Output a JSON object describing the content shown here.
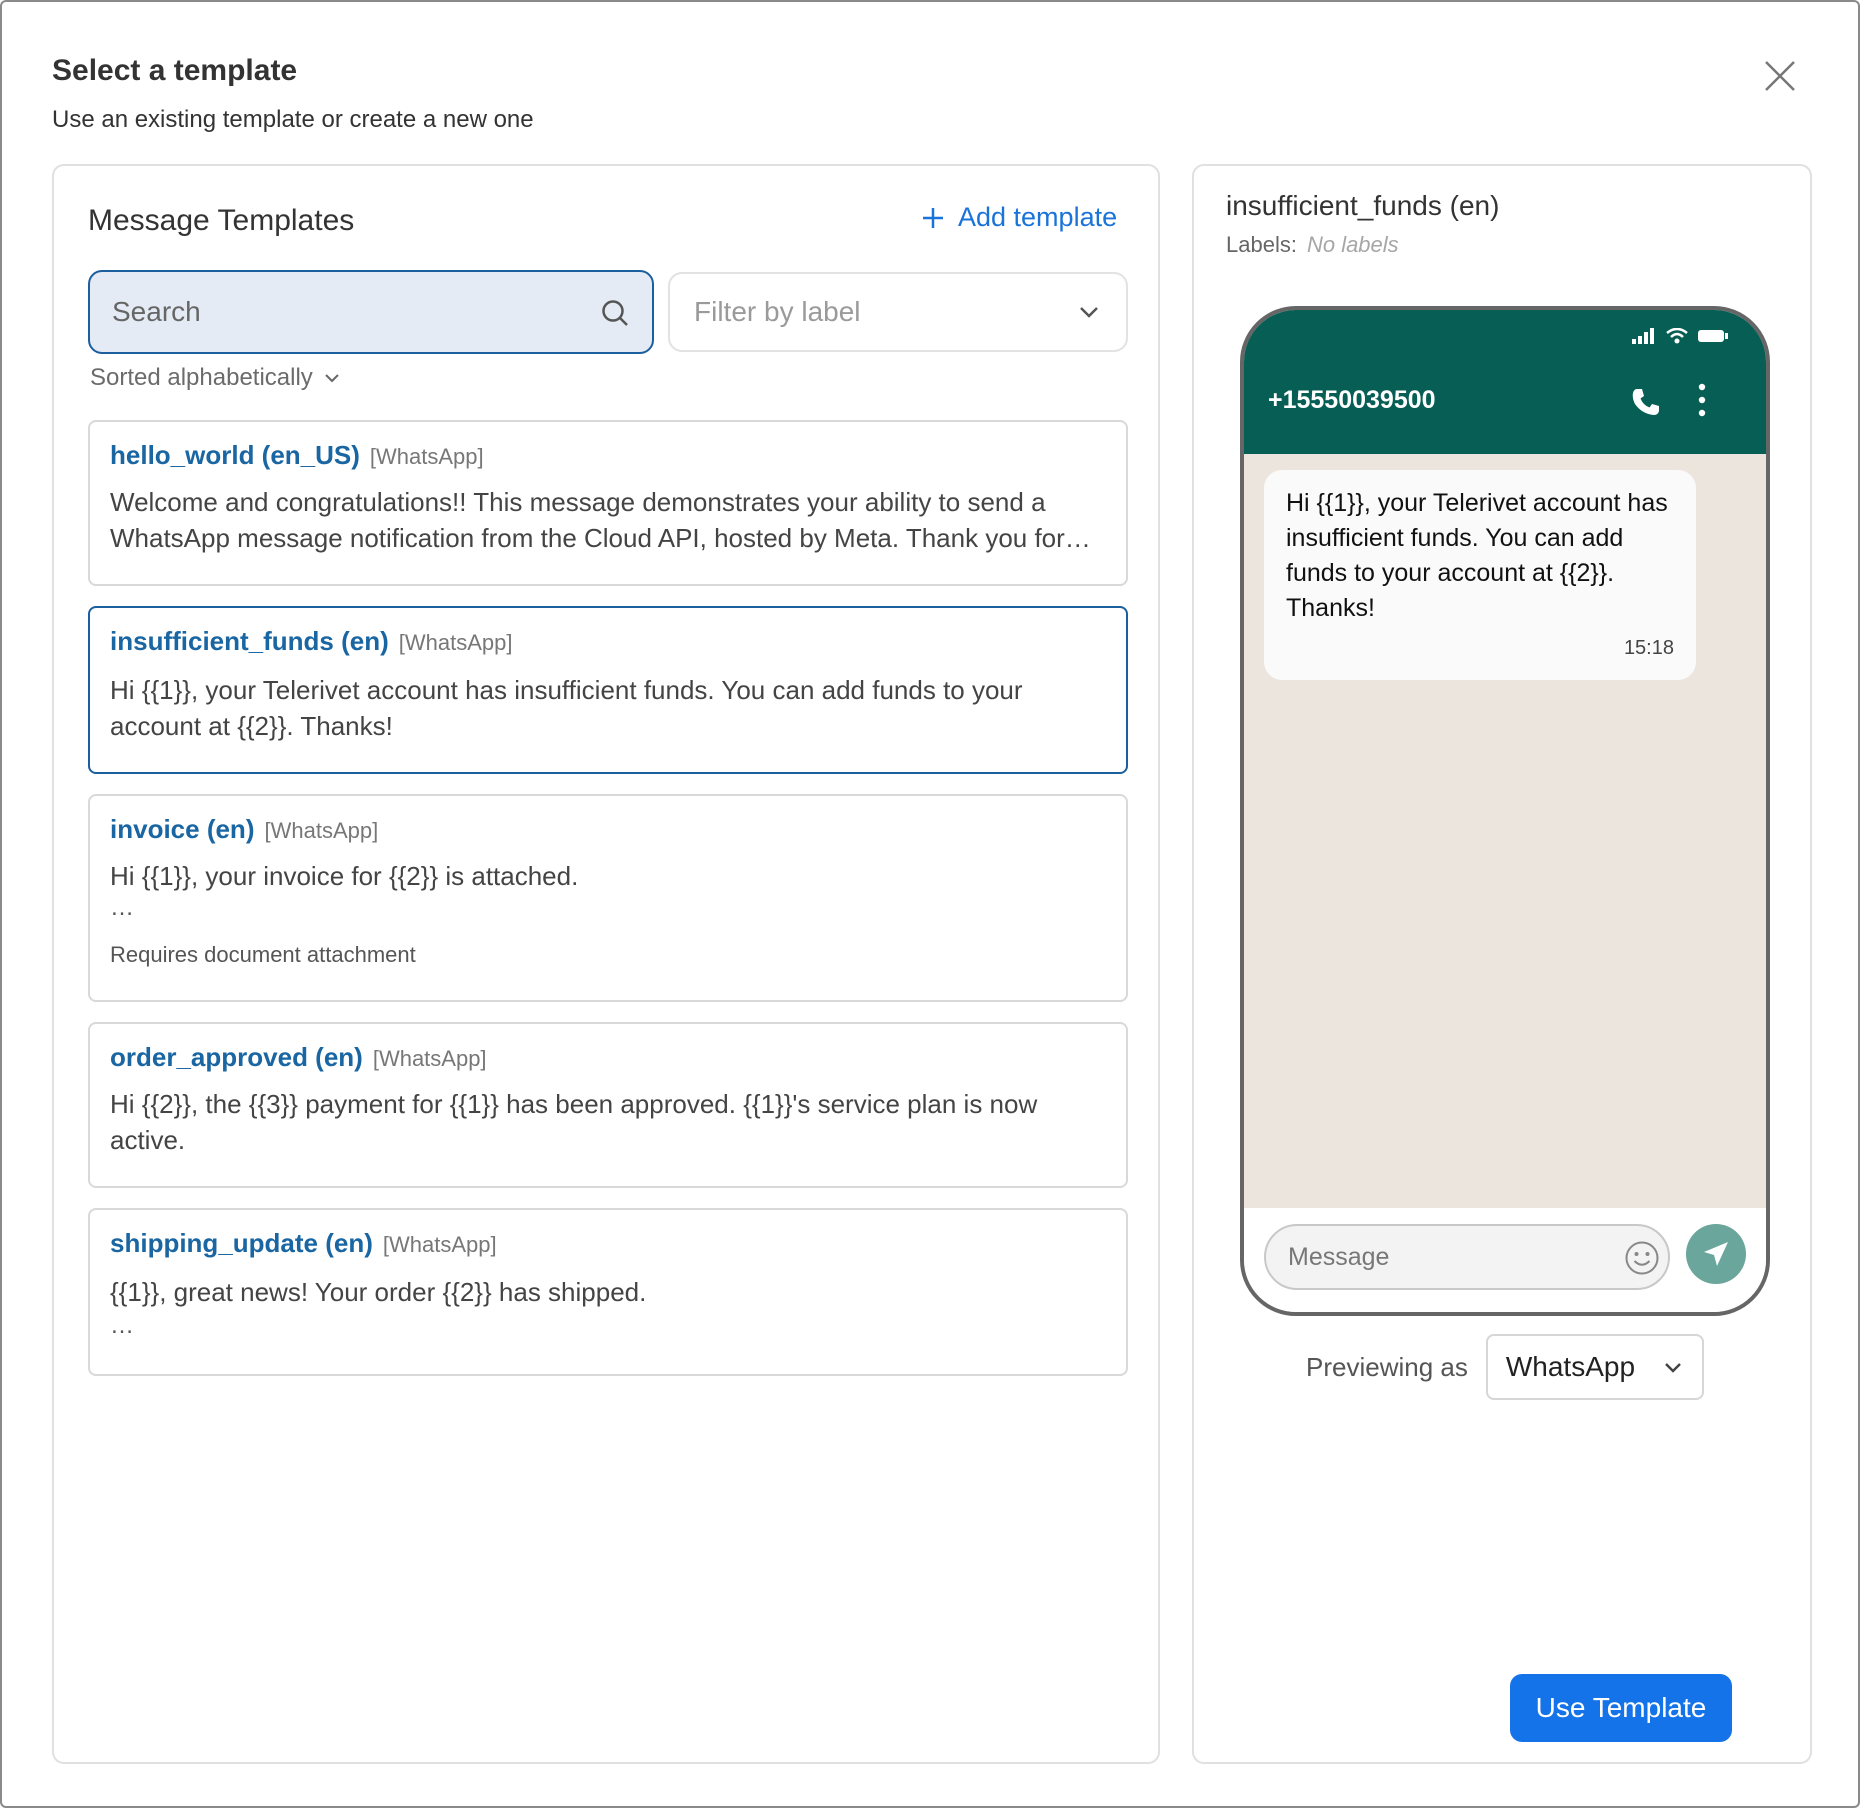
{
  "header": {
    "title": "Select a template",
    "subtitle": "Use an existing template or create a new one"
  },
  "list_panel": {
    "title": "Message Templates",
    "add_label": "Add template",
    "search_placeholder": "Search",
    "filter_placeholder": "Filter by label",
    "sort_label": "Sorted alphabetically"
  },
  "templates": [
    {
      "name": "hello_world (en_US)",
      "channel": "[WhatsApp]",
      "body": "Welcome and congratulations!! This message demonstrates your ability to send a WhatsApp message notification from the Cloud API, hosted by Meta. Thank you for…"
    },
    {
      "name": "insufficient_funds (en)",
      "channel": "[WhatsApp]",
      "body": "Hi {{1}}, your Telerivet account has insufficient funds. You can add funds to your account at {{2}}. Thanks!"
    },
    {
      "name": "invoice (en)",
      "channel": "[WhatsApp]",
      "body": "Hi {{1}}, your invoice for {{2}} is attached.",
      "ellipsis": "…",
      "note": "Requires document attachment"
    },
    {
      "name": "order_approved (en)",
      "channel": "[WhatsApp]",
      "body": "Hi {{2}}, the {{3}} payment for {{1}} has been approved. {{1}}'s service plan is now active."
    },
    {
      "name": "shipping_update (en)",
      "channel": "[WhatsApp]",
      "body": "{{1}}, great news! Your order {{2}} has shipped.",
      "ellipsis": "…"
    }
  ],
  "preview": {
    "title": "insufficient_funds (en)",
    "labels_label": "Labels:",
    "labels_value": "No labels",
    "phone_number": "+15550039500",
    "message": "Hi {{1}}, your Telerivet account has insufficient funds. You can add funds to your account at {{2}}. Thanks!",
    "time": "15:18",
    "compose_placeholder": "Message",
    "previewing_as_label": "Previewing as",
    "channel": "WhatsApp",
    "use_button": "Use Template"
  },
  "colors": {
    "accent": "#1573ea",
    "link": "#1a66a3",
    "whatsapp_header": "#075e54",
    "chat_bg": "#ece5de"
  }
}
